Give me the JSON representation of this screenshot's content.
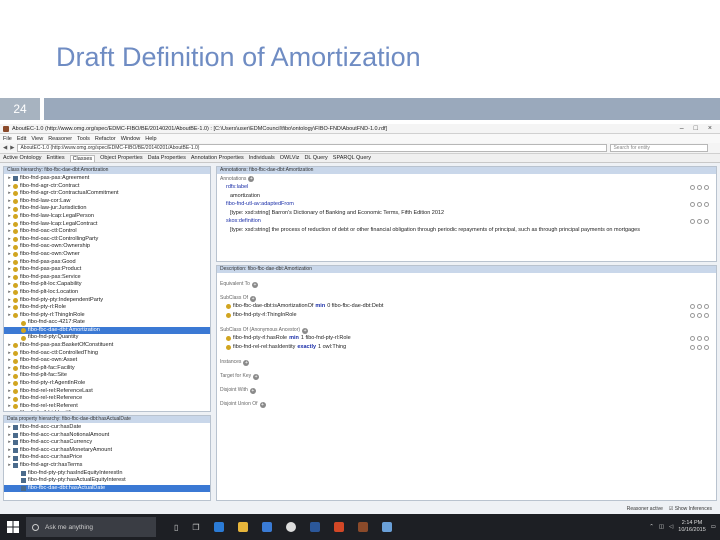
{
  "slide": {
    "title": "Draft Definition of Amortization",
    "number": "24"
  },
  "window": {
    "title": "AboutEC-1.0 (http://www.omg.org/spec/EDMC-FIBO/BE/20140201/AboutBE-1.0) : [C:\\Users\\user\\EDMCouncil\\fibo\\ontology\\FIBO-FND\\AboutFND-1.0.rdf]",
    "controls": [
      "–",
      "□",
      "×"
    ]
  },
  "menu": [
    "File",
    "Edit",
    "View",
    "Reasoner",
    "Tools",
    "Refactor",
    "Window",
    "Help"
  ],
  "address": {
    "value": "AboutEC-1.0 (http://www.omg.org/spec/EDMC-FIBO/BE/20140201/AboutBE-1.0)",
    "search_placeholder": "Search for entity"
  },
  "tabs": [
    "Active Ontology",
    "Entities",
    "Classes",
    "Object Properties",
    "Data Properties",
    "Annotation Properties",
    "Individuals",
    "OWLViz",
    "DL Query",
    "SPARQL Query"
  ],
  "class_hierarchy": {
    "header": "Class hierarchy: fibo-fbc-dae-dbt:Amortization",
    "items": [
      {
        "icon": "sq",
        "indent": 0,
        "label": "fibo-fnd-pas-pas:Agreement"
      },
      {
        "icon": "dot",
        "indent": 0,
        "label": "fibo-fnd-agr-ctr:Contract"
      },
      {
        "icon": "dot",
        "indent": 0,
        "label": "fibo-fnd-agr-ctr:ContractualCommitment"
      },
      {
        "icon": "dot",
        "indent": 0,
        "label": "fibo-fnd-law-cor:Law"
      },
      {
        "icon": "dot",
        "indent": 0,
        "label": "fibo-fnd-law-jur:Jurisdiction"
      },
      {
        "icon": "dot",
        "indent": 0,
        "label": "fibo-fnd-law-lcap:LegalPerson"
      },
      {
        "icon": "dot",
        "indent": 0,
        "label": "fibo-fnd-law-lcap:LegalContract"
      },
      {
        "icon": "dot",
        "indent": 0,
        "label": "fibo-fnd-oac-ctl:Control"
      },
      {
        "icon": "dot",
        "indent": 0,
        "label": "fibo-fnd-oac-ctl:ControllingParty"
      },
      {
        "icon": "dot",
        "indent": 0,
        "label": "fibo-fnd-oac-own:Ownership"
      },
      {
        "icon": "dot",
        "indent": 0,
        "label": "fibo-fnd-oac-own:Owner"
      },
      {
        "icon": "dot",
        "indent": 0,
        "label": "fibo-fnd-pas-pas:Good"
      },
      {
        "icon": "dot",
        "indent": 0,
        "label": "fibo-fnd-pas-pas:Product"
      },
      {
        "icon": "dot",
        "indent": 0,
        "label": "fibo-fnd-pas-pas:Service"
      },
      {
        "icon": "dot",
        "indent": 0,
        "label": "fibo-fnd-plt-loc:Capability"
      },
      {
        "icon": "dot",
        "indent": 0,
        "label": "fibo-fnd-plt-loc:Location"
      },
      {
        "icon": "dot",
        "indent": 0,
        "label": "fibo-fnd-pty-pty:IndependentParty"
      },
      {
        "icon": "dot",
        "indent": 0,
        "label": "fibo-fnd-pty-rl:Role"
      },
      {
        "icon": "dot",
        "indent": 0,
        "label": "fibo-fnd-pty-rl:ThingInRole"
      },
      {
        "icon": "dot",
        "indent": 1,
        "label": "fibo-fnd-acc-4217:Rate"
      },
      {
        "icon": "dot",
        "indent": 1,
        "label": "fibo-fbc-dae-dbt:Amortization",
        "selected": true
      },
      {
        "icon": "dot",
        "indent": 1,
        "label": "fibo-fnd-pty:Quantity"
      },
      {
        "icon": "dot",
        "indent": 0,
        "label": "fibo-fnd-pas-pas:BasketOfConstituent"
      },
      {
        "icon": "dot",
        "indent": 0,
        "label": "fibo-fnd-oac-ctl:ControlledThing"
      },
      {
        "icon": "dot",
        "indent": 0,
        "label": "fibo-fnd-oac-own:Asset"
      },
      {
        "icon": "dot",
        "indent": 0,
        "label": "fibo-fnd-plt-fac:Facility"
      },
      {
        "icon": "dot",
        "indent": 0,
        "label": "fibo-fnd-plt-fac:Site"
      },
      {
        "icon": "dot",
        "indent": 0,
        "label": "fibo-fnd-pty-rl:AgentInRole"
      },
      {
        "icon": "dot",
        "indent": 0,
        "label": "fibo-fnd-rel-rel:ReferenceLast"
      },
      {
        "icon": "dot",
        "indent": 0,
        "label": "fibo-fnd-rel-rel:Reference"
      },
      {
        "icon": "dot",
        "indent": 0,
        "label": "fibo-fnd-rel-rel:Referent"
      },
      {
        "icon": "dot",
        "indent": 0,
        "label": "fibo-fnd-utl-bt:Identifier"
      }
    ]
  },
  "data_property_hierarchy": {
    "header": "Data property hierarchy: fibo-fbc-dae-dbt:hasActualDate",
    "items": [
      {
        "icon": "sq",
        "indent": 0,
        "label": "fibo-fnd-acc-cur:hasDate"
      },
      {
        "icon": "sq",
        "indent": 0,
        "label": "fibo-fnd-acc-cur:hasNotionalAmount"
      },
      {
        "icon": "sq",
        "indent": 0,
        "label": "fibo-fnd-acc-cur:hasCurrency"
      },
      {
        "icon": "sq",
        "indent": 0,
        "label": "fibo-fnd-acc-cur:hasMonetaryAmount"
      },
      {
        "icon": "sq",
        "indent": 0,
        "label": "fibo-fnd-acc-cur:hasPrice"
      },
      {
        "icon": "sq",
        "indent": 0,
        "label": "fibo-fnd-agr-ctr:hasTerms"
      },
      {
        "icon": "sq",
        "indent": 1,
        "label": "fibo-fnd-pty-pty:hasIndEquityInterestIn"
      },
      {
        "icon": "sq",
        "indent": 1,
        "label": "fibo-fnd-pty-pty:hasActualEquityInterest"
      },
      {
        "icon": "sq",
        "indent": 1,
        "label": "fibo-fbc-dae-dbt:hasActualDate",
        "selected": true
      }
    ]
  },
  "annotations": {
    "header": "Annotations: fibo-fbc-dae-dbt:Amortization",
    "section_label": "Annotations",
    "rows": [
      {
        "label": "rdfs:label",
        "value": "amortization"
      },
      {
        "label": "fibo-fnd-utl-av:adaptedFrom",
        "value": "[type: xsd:string]  Barron's Dictionary of Banking and Economic Terms, Fifth Edition 2012"
      },
      {
        "label": "skos:definition",
        "value": "[type: xsd:string]  the process of reduction of debt or other financial obligation through periodic repayments of principal, such as through principal payments on mortgages"
      }
    ]
  },
  "description": {
    "header": "Description: fibo-fbc-dae-dbt:Amortization",
    "sections": [
      {
        "label": "Equivalent To",
        "lines": []
      },
      {
        "label": "SubClass Of",
        "lines": [
          {
            "pre": "fibo-fbc-dae-dbt:isAmortizationOf",
            "kw": "min",
            "post": "0 fibo-fbc-dae-dbt:Debt"
          },
          {
            "pre": "fibo-fnd-pty-rl:ThingInRole",
            "kw": "",
            "post": ""
          }
        ]
      },
      {
        "label": "SubClass Of (Anonymous Ancestor)",
        "lines": [
          {
            "pre": "fibo-fnd-pty-rl:hasRole",
            "kw": "min",
            "post": "1 fibo-fnd-pty-rl:Role"
          },
          {
            "pre": "fibo-fnd-rel-rel:hasIdentity",
            "kw": "exactly",
            "post": "1 owl:Thing"
          }
        ]
      },
      {
        "label": "Instances",
        "lines": []
      },
      {
        "label": "Target for Key",
        "lines": []
      },
      {
        "label": "Disjoint With",
        "lines": []
      },
      {
        "label": "Disjoint Union Of",
        "lines": []
      }
    ]
  },
  "status": {
    "reasoner": "Reasoner active",
    "show_inferences": "Show Inferences"
  },
  "taskbar": {
    "search_placeholder": "Ask me anything",
    "time": "2:14 PM",
    "date": "10/16/2015"
  },
  "colors": {
    "title": "#6f8cc3",
    "band": "#9aa9bc",
    "selection": "#3b79d4",
    "class_dot": "#d1a520",
    "panel_header": "#c9d7ea"
  }
}
